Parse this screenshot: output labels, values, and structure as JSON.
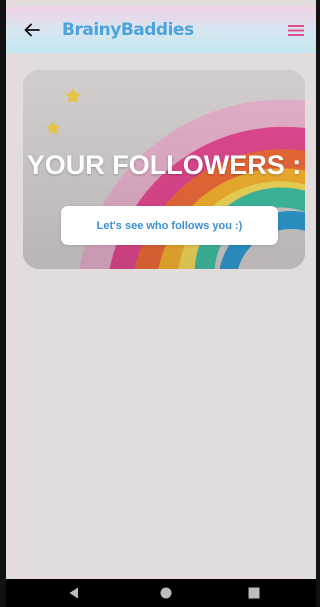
{
  "appbar": {
    "title": "BrainyBaddies",
    "back_icon": "arrow-left-icon",
    "menu_icon": "hamburger-menu-icon",
    "menu_color": "#e0508a"
  },
  "card": {
    "title": "YOUR FOLLOWERS :",
    "button_label": "Let's see who follows you :)"
  },
  "navbar": {
    "back_icon": "triangle-back-icon",
    "home_icon": "circle-home-icon",
    "recents_icon": "square-recents-icon"
  },
  "colors": {
    "accent": "#4ca3dd",
    "background": "#e2dcdc"
  }
}
